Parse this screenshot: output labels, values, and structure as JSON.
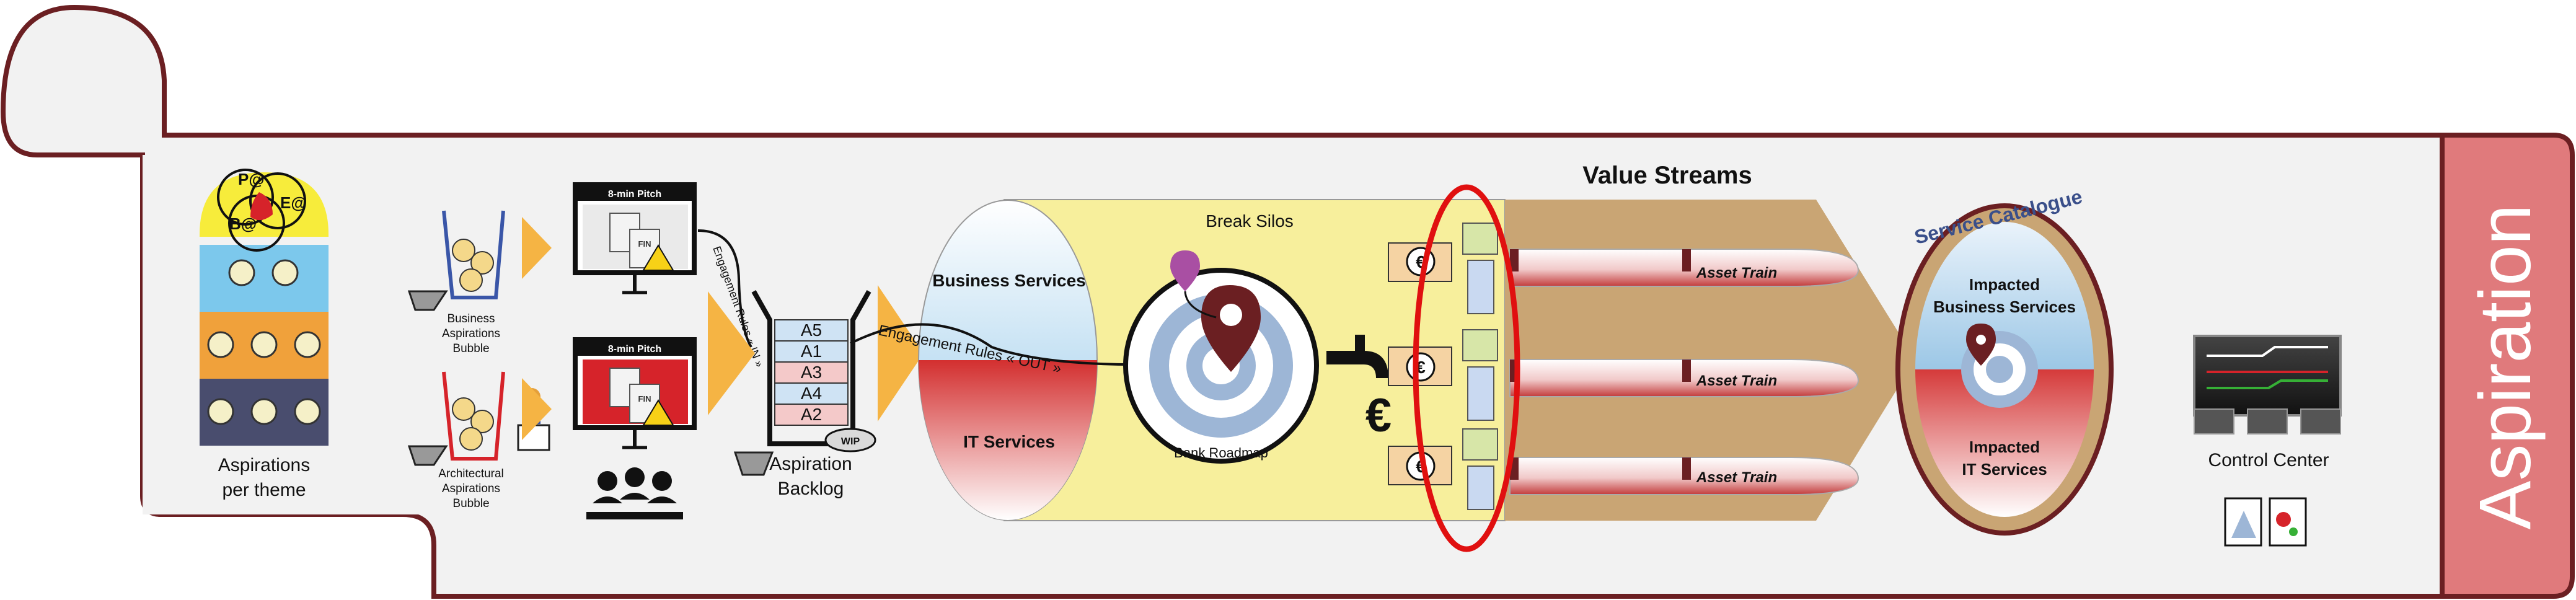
{
  "side_tab": {
    "label": "Aspiration"
  },
  "themes": {
    "caption_line1": "Aspirations",
    "caption_line2": "per theme",
    "venn": [
      "P@",
      "E@",
      "B@"
    ]
  },
  "bubbles": {
    "business": [
      "Business",
      "Aspirations",
      "Bubble"
    ],
    "architectural": [
      "Architectural",
      "Aspirations",
      "Bubble"
    ]
  },
  "pitch": {
    "top_title": "8-min Pitch",
    "bottom_title": "8-min Pitch",
    "doc_label": "FIN"
  },
  "engagement_in": "Engagement Rules « IN »",
  "engagement_out": "Engagement Rules «  OUT  »",
  "backlog": {
    "items": [
      "A5",
      "A1",
      "A3",
      "A4",
      "A2"
    ],
    "wip": "WIP",
    "caption_line1": "Aspiration",
    "caption_line2": "Backlog"
  },
  "silos": {
    "title": "Break Silos",
    "business": "Business Services",
    "it": "IT Services",
    "roadmap": "Bank Roadmap",
    "currency": "€"
  },
  "value_streams": {
    "title": "Value Streams",
    "trains": [
      "Asset Train",
      "Asset Train",
      "Asset Train"
    ],
    "coin": "€"
  },
  "service_catalogue": {
    "title": "Service Catalogue",
    "business_line1": "Impacted",
    "business_line2": "Business Services",
    "it_line1": "Impacted",
    "it_line2": "IT Services"
  },
  "control_center": {
    "label": "Control Center"
  },
  "colors": {
    "frame": "#6b1f22",
    "tab": "#e07a7c",
    "panel": "#f2f2f2",
    "silo_yellow": "#f7ef9c",
    "arrow_orange": "#f5b444",
    "stream_tan": "#c9a574",
    "highlight": "#e01010",
    "it_red": "#d32f2f",
    "biz_blue": "#8cc4e8"
  }
}
